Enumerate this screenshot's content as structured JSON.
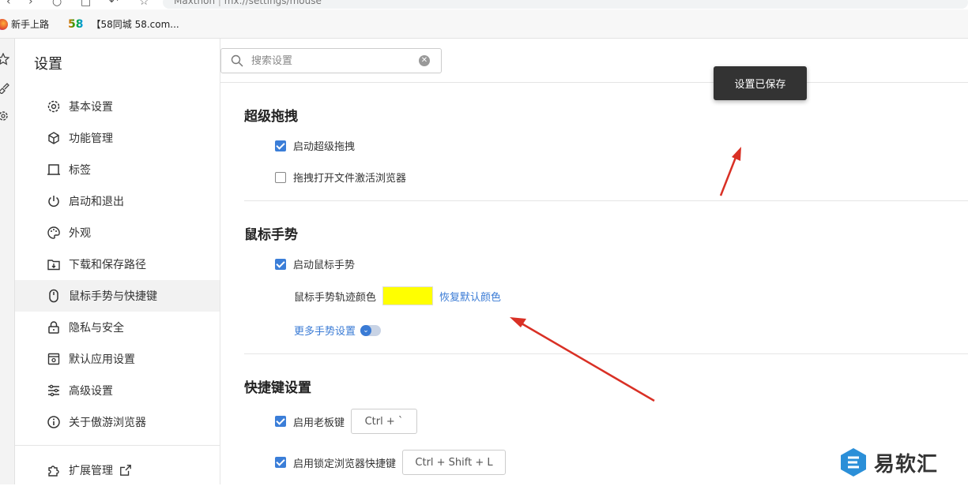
{
  "browser": {
    "url": "mx://settings/mouse",
    "url_prefix": "Maxthon",
    "bookmarks": [
      {
        "label": "新手上路"
      },
      {
        "label": "【58同城 58.com..."
      }
    ],
    "bookmark_58_logo": "58"
  },
  "sidebar": {
    "title": "设置",
    "items": [
      {
        "label": "基本设置",
        "icon": "gear-icon"
      },
      {
        "label": "功能管理",
        "icon": "cube-icon"
      },
      {
        "label": "标签",
        "icon": "tab-icon"
      },
      {
        "label": "启动和退出",
        "icon": "power-icon"
      },
      {
        "label": "外观",
        "icon": "palette-icon"
      },
      {
        "label": "下载和保存路径",
        "icon": "download-icon"
      },
      {
        "label": "鼠标手势与快捷键",
        "icon": "mouse-icon",
        "active": true
      },
      {
        "label": "隐私与安全",
        "icon": "lock-icon"
      },
      {
        "label": "默认应用设置",
        "icon": "app-icon"
      },
      {
        "label": "高级设置",
        "icon": "sliders-icon"
      },
      {
        "label": "关于傲游浏览器",
        "icon": "info-icon"
      }
    ],
    "extensions": {
      "label": "扩展管理",
      "icon": "puzzle-icon"
    }
  },
  "search": {
    "placeholder": "搜索设置"
  },
  "sections": {
    "super_drag": {
      "title": "超级拖拽",
      "enable_label": "启动超级拖拽",
      "enable_checked": true,
      "open_file_label": "拖拽打开文件激活浏览器",
      "open_file_checked": false
    },
    "mouse_gesture": {
      "title": "鼠标手势",
      "enable_label": "启动鼠标手势",
      "enable_checked": true,
      "color_label": "鼠标手势轨迹颜色",
      "color_value": "#ffff00",
      "reset_label": "恢复默认颜色",
      "more_label": "更多手势设置"
    },
    "shortcuts": {
      "title": "快捷键设置",
      "boss_key_label": "启用老板键",
      "boss_key_checked": true,
      "boss_key_value": "Ctrl + `",
      "lock_label": "启用锁定浏览器快捷键",
      "lock_checked": true,
      "lock_value": "Ctrl + Shift + L"
    }
  },
  "toast": {
    "text": "设置已保存"
  },
  "watermark": {
    "text": "易软汇"
  },
  "colors": {
    "accent": "#3b7ed8",
    "link": "#3a7bd5",
    "annotation": "#d93025"
  }
}
